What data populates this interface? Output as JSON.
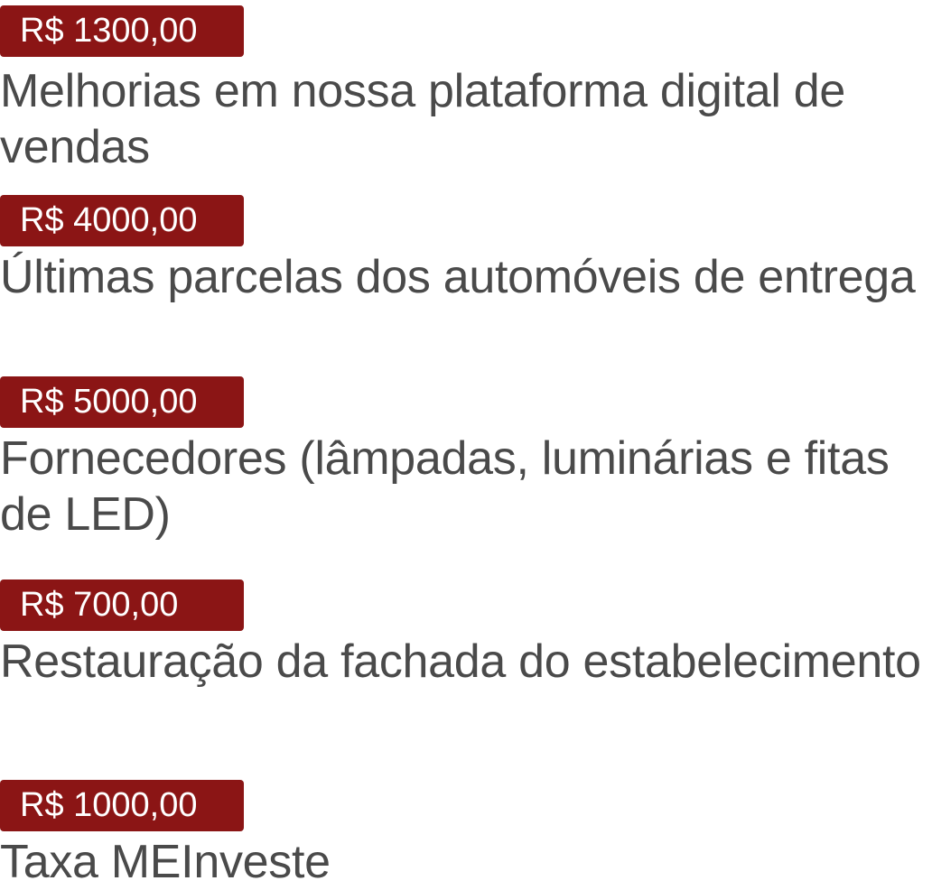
{
  "items": [
    {
      "amount": "R$ 1300,00",
      "description": "Melhorias em nossa plataforma digital de vendas"
    },
    {
      "amount": "R$ 4000,00",
      "description": "Últimas parcelas dos automóveis de entrega"
    },
    {
      "amount": "R$ 5000,00",
      "description": "Fornecedores (lâmpadas, luminárias e fitas de LED)"
    },
    {
      "amount": "R$ 700,00",
      "description": "Restauração da fachada do estabelecimento"
    },
    {
      "amount": "R$ 1000,00",
      "description": "Taxa MEInveste"
    }
  ],
  "colors": {
    "badge_background": "#8b1515",
    "badge_text": "#ffffff",
    "description_text": "#4a4a4a"
  }
}
